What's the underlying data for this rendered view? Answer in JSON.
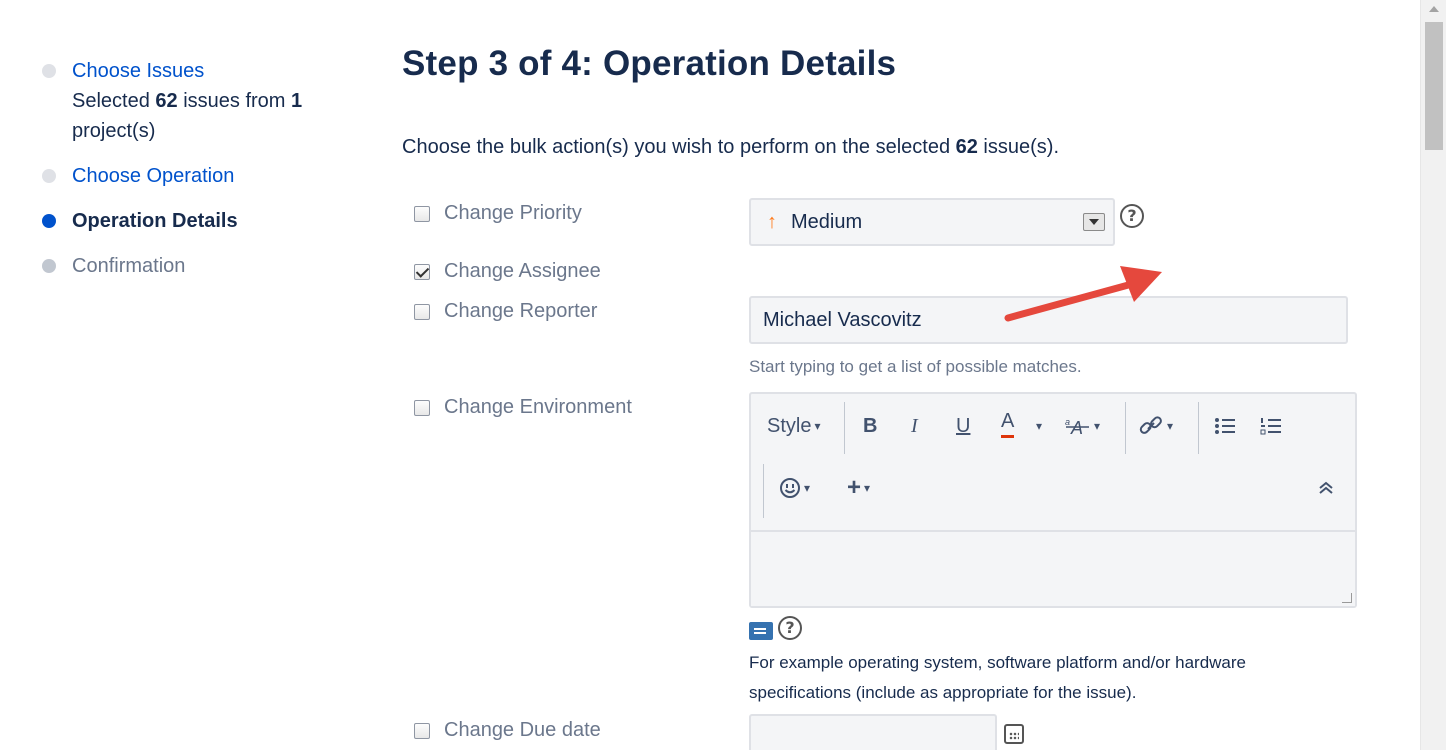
{
  "sidebar": {
    "steps": [
      {
        "label": "Choose Issues",
        "sub_prefix": "Selected ",
        "sub_count": "62",
        "sub_mid": " issues from ",
        "sub_projects": "1",
        "sub_suffix": "project(s)",
        "state": "done"
      },
      {
        "label": "Choose Operation",
        "state": "done"
      },
      {
        "label": "Operation Details",
        "state": "active"
      },
      {
        "label": "Confirmation",
        "state": "pending"
      }
    ]
  },
  "main": {
    "title": "Step 3 of 4: Operation Details",
    "intro_prefix": "Choose the bulk action(s) you wish to perform on the selected ",
    "intro_count": "62",
    "intro_suffix": " issue(s).",
    "fields": {
      "priority": {
        "label": "Change Priority",
        "checked": false,
        "value": "Medium",
        "icon": "arrow-up-icon",
        "icon_color": "#ff7a1a"
      },
      "assignee": {
        "label": "Change Assignee",
        "checked": true
      },
      "reporter": {
        "label": "Change Reporter",
        "checked": false,
        "value": "Michael Vascovitz",
        "hint": "Start typing to get a list of possible matches."
      },
      "environment": {
        "label": "Change Environment",
        "checked": false,
        "toolbar": {
          "style_label": "Style",
          "bold": "B",
          "italic": "I",
          "underline": "U",
          "text_color": "A"
        },
        "help_text": "For example operating system, software platform and/or hardware specifications (include as appropriate for the issue)."
      },
      "due_date": {
        "label": "Change Due date",
        "checked": false
      }
    },
    "help_symbol": "?"
  },
  "annotation": {
    "color": "#e5483d",
    "type": "arrow"
  }
}
